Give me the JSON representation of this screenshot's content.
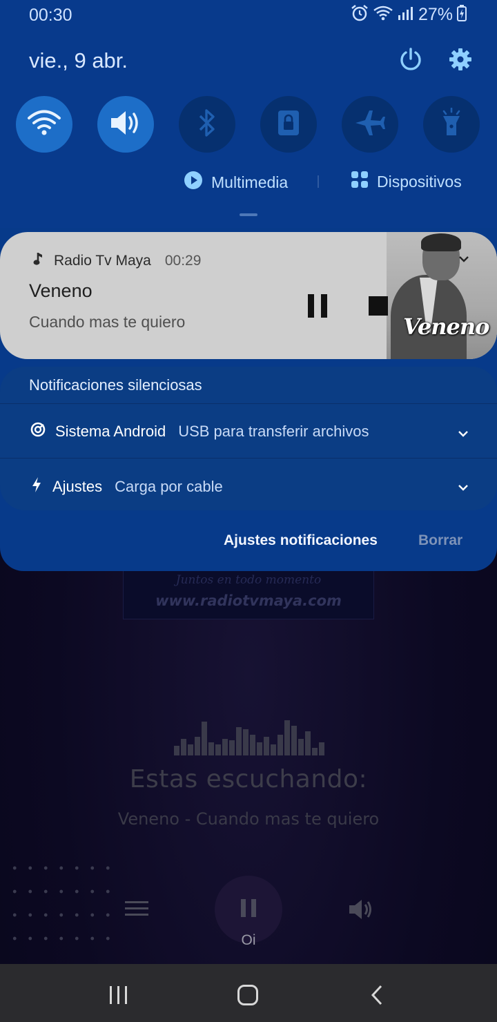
{
  "status_bar": {
    "time": "00:30",
    "battery": "27%",
    "icons": [
      "alarm-icon",
      "wifi-icon",
      "signal-icon",
      "battery-charging-icon"
    ]
  },
  "quick_panel": {
    "date": "vie., 9 abr.",
    "tiles": [
      {
        "name": "wifi",
        "icon": "wifi-icon",
        "active": true
      },
      {
        "name": "sound",
        "icon": "volume-icon",
        "active": true
      },
      {
        "name": "bluetooth",
        "icon": "bluetooth-icon",
        "active": false
      },
      {
        "name": "rotation-lock",
        "icon": "lock-icon",
        "active": false
      },
      {
        "name": "airplane-mode",
        "icon": "airplane-icon",
        "active": false
      },
      {
        "name": "flashlight",
        "icon": "flashlight-icon",
        "active": false
      }
    ],
    "media_label": "Multimedia",
    "devices_label": "Dispositivos"
  },
  "media_notification": {
    "app": "Radio Tv Maya",
    "time": "00:29",
    "title": "Veneno",
    "artist": "Cuando mas te quiero",
    "album_art_text": "Veneno"
  },
  "silent_notifications": {
    "header": "Notificaciones silenciosas",
    "items": [
      {
        "app": "Sistema Android",
        "message": "USB para transferir archivos",
        "icon": "android-system-icon"
      },
      {
        "app": "Ajustes",
        "message": "Carga por cable",
        "icon": "charging-bolt-icon"
      }
    ]
  },
  "panel_actions": {
    "settings": "Ajustes notificaciones",
    "clear": "Borrar"
  },
  "background_app": {
    "banner_tagline": "Juntos en todo momento",
    "banner_url": "www.radiotvmaya.com",
    "now_playing_label": "Estas escuchando:",
    "now_playing_track": "Veneno - Cuando mas te quiero",
    "play_label": "Oi",
    "equalizer_levels": [
      0.25,
      0.45,
      0.3,
      0.5,
      0.9,
      0.35,
      0.3,
      0.45,
      0.4,
      0.75,
      0.7,
      0.55,
      0.35,
      0.5,
      0.3,
      0.55,
      0.95,
      0.8,
      0.45,
      0.65,
      0.2,
      0.35
    ]
  },
  "navigation_bar": {
    "buttons": [
      "recents-icon",
      "home-icon",
      "back-icon"
    ]
  },
  "colors": {
    "panel_blue": "#083a8c",
    "tile_active": "#1d6ec8",
    "tile_inactive": "#06306f",
    "media_card": "#cfcfcf",
    "accent_light": "#8fd0ff"
  }
}
